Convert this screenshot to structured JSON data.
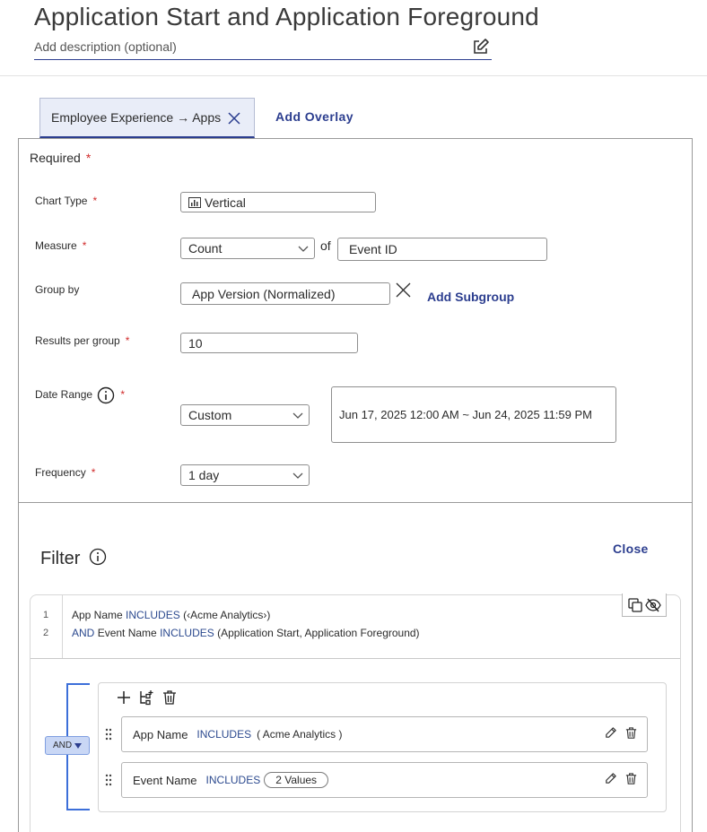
{
  "header": {
    "title": "Application Start and Application Foreground",
    "description_placeholder": "Add description (optional)"
  },
  "tabs": {
    "active_label": "Employee Experience → Apps",
    "add_overlay": "Add Overlay"
  },
  "required": {
    "title": "Required",
    "star": "*",
    "chart_type": {
      "label": "Chart Type",
      "value": "Vertical"
    },
    "measure": {
      "label": "Measure",
      "value": "Count",
      "of": "of",
      "target": "Event ID"
    },
    "group_by": {
      "label": "Group by",
      "value": "App Version (Normalized)",
      "add_subgroup": "Add Subgroup"
    },
    "results_per_group": {
      "label": "Results per group",
      "value": "10"
    },
    "date_range": {
      "label": "Date Range",
      "preset": "Custom",
      "range": "Jun 17, 2025 12:00 AM ~ Jun 24, 2025 11:59 PM"
    },
    "frequency": {
      "label": "Frequency",
      "value": "1 day"
    }
  },
  "filter": {
    "title": "Filter",
    "close": "Close",
    "code_lines": [
      {
        "num": "1",
        "prefix": "",
        "field": "App Name",
        "op": "INCLUDES",
        "value": "(‹Acme Analytics›)"
      },
      {
        "num": "2",
        "prefix": "AND",
        "field": "Event Name",
        "op": "INCLUDES",
        "value": "(Application Start, Application Foreground)"
      }
    ],
    "group_operator": "AND",
    "rules": [
      {
        "field": "App Name",
        "op": "INCLUDES",
        "value": "( Acme Analytics )"
      },
      {
        "field": "Event Name",
        "op": "INCLUDES",
        "value": "2 Values"
      }
    ]
  },
  "colors": {
    "accent": "#2c3e8f",
    "required_star": "#d12b2b",
    "bracket": "#3c6fd9",
    "and_button_bg": "#c9d7f5"
  }
}
